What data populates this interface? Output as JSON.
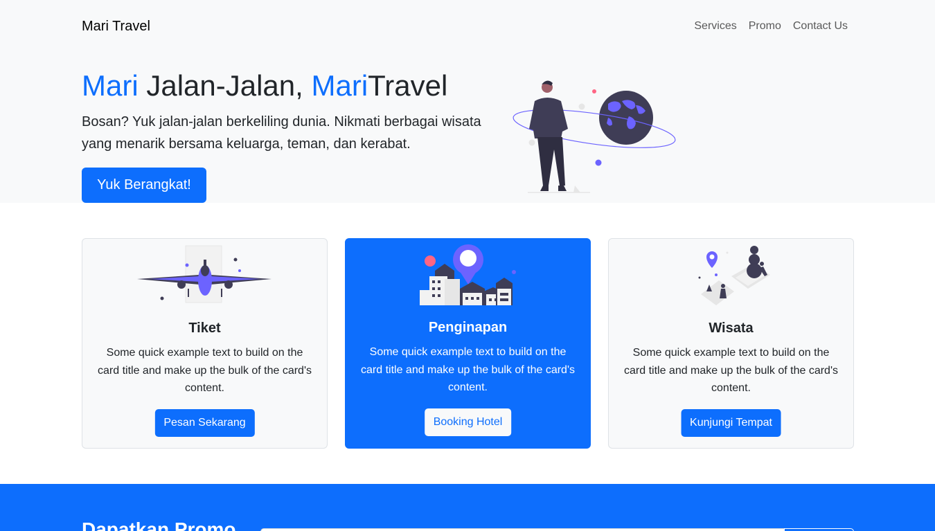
{
  "navbar": {
    "brand": "Mari Travel",
    "links": [
      "Services",
      "Promo",
      "Contact Us"
    ]
  },
  "hero": {
    "title_part1": "Mari",
    "title_part2": " Jalan-Jalan, ",
    "title_part3": "Mari",
    "title_part4": "Travel",
    "text": "Bosan? Yuk jalan-jalan berkeliling dunia. Nikmati berbagai wisata yang menarik bersama keluarga, teman, dan kerabat.",
    "button": "Yuk Berangkat!",
    "illustration_icon": "traveler-globe-illustration"
  },
  "cards": [
    {
      "title": "Tiket",
      "text": "Some quick example text to build on the card title and make up the bulk of the card's content.",
      "button": "Pesan Sekarang",
      "icon": "airplane-illustration"
    },
    {
      "title": "Penginapan",
      "text": "Some quick example text to build on the card title and make up the bulk of the card's content.",
      "button": "Booking Hotel",
      "icon": "hotel-illustration"
    },
    {
      "title": "Wisata",
      "text": "Some quick example text to build on the card title and make up the bulk of the card's content.",
      "button": "Kunjungi Tempat",
      "icon": "map-pin-illustration"
    }
  ],
  "promo": {
    "title": "Dapatkan Promo"
  },
  "colors": {
    "primary": "#0d6efd",
    "light": "#f8f9fa",
    "illustration_purple": "#6c63ff",
    "illustration_dark": "#3f3d56"
  }
}
